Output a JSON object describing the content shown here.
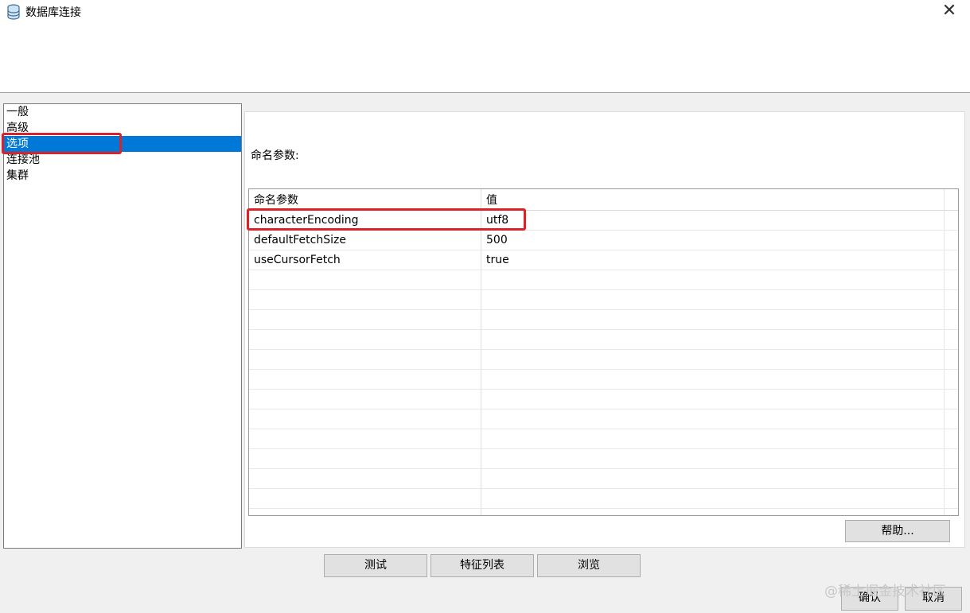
{
  "window": {
    "title": "数据库连接",
    "icon": "database-icon",
    "close_glyph": "✕"
  },
  "sidebar": {
    "items": [
      {
        "label": "一般"
      },
      {
        "label": "高级"
      },
      {
        "label": "选项",
        "selected": true
      },
      {
        "label": "连接池"
      },
      {
        "label": "集群"
      }
    ]
  },
  "options": {
    "section_label": "命名参数:",
    "table": {
      "columns": [
        "命名参数",
        "值"
      ],
      "rows": [
        {
          "name": "characterEncoding",
          "value": "utf8"
        },
        {
          "name": "defaultFetchSize",
          "value": "500"
        },
        {
          "name": "useCursorFetch",
          "value": "true"
        }
      ]
    },
    "help_button": "帮助..."
  },
  "actions": {
    "test": "测试",
    "features": "特征列表",
    "browse": "浏览",
    "ok": "确认",
    "cancel": "取消"
  },
  "watermark": "@稀土掘金技术社区",
  "colors": {
    "selection": "#0078d7",
    "annotation": "#d9222a"
  }
}
